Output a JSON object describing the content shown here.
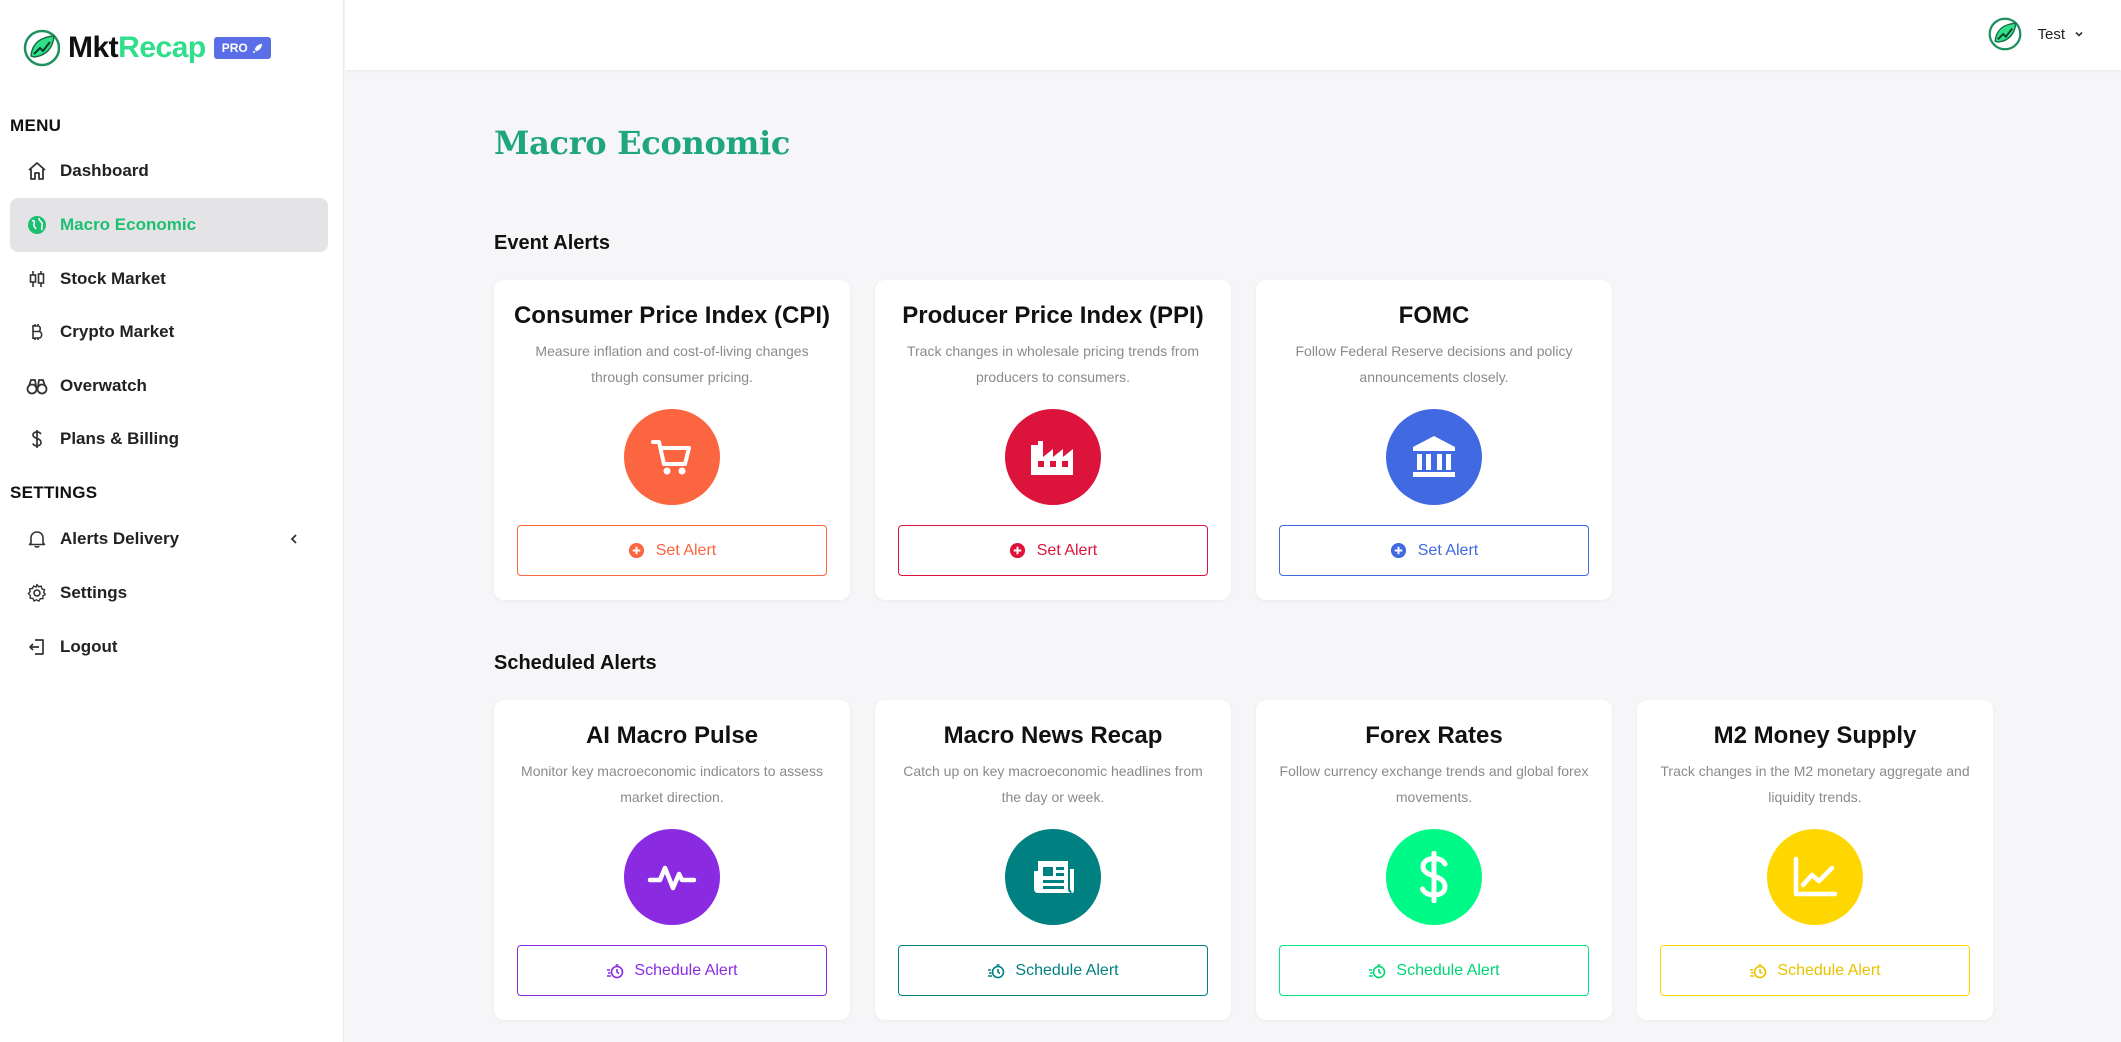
{
  "app": {
    "logo_part1": "Mkt",
    "logo_part2": "Recap",
    "badge": "PRO"
  },
  "sidebar": {
    "menu_label": "MENU",
    "menu_items": [
      {
        "label": "Dashboard",
        "icon": "home-icon"
      },
      {
        "label": "Macro Economic",
        "icon": "globe-icon",
        "active": true
      },
      {
        "label": "Stock Market",
        "icon": "candlestick-icon"
      },
      {
        "label": "Crypto Market",
        "icon": "bitcoin-icon"
      },
      {
        "label": "Overwatch",
        "icon": "binoculars-icon"
      },
      {
        "label": "Plans & Billing",
        "icon": "dollar-icon"
      }
    ],
    "settings_label": "SETTINGS",
    "settings_items": [
      {
        "label": "Alerts Delivery",
        "icon": "bell-icon"
      },
      {
        "label": "Settings",
        "icon": "gear-icon"
      },
      {
        "label": "Logout",
        "icon": "logout-icon"
      }
    ]
  },
  "topbar": {
    "user_name": "Test"
  },
  "main": {
    "page_title": "Macro Economic",
    "event_alerts": {
      "title": "Event Alerts",
      "cards": [
        {
          "title": "Consumer Price Index (CPI)",
          "desc": "Measure inflation and cost-of-living changes through consumer pricing.",
          "icon": "cart-icon",
          "button": "Set Alert",
          "color": "#fb6540"
        },
        {
          "title": "Producer Price Index (PPI)",
          "desc": "Track changes in wholesale pricing trends from producers to consumers.",
          "icon": "factory-icon",
          "button": "Set Alert",
          "color": "#dc143c"
        },
        {
          "title": "FOMC",
          "desc": "Follow Federal Reserve decisions and policy announcements closely.",
          "icon": "bank-icon",
          "button": "Set Alert",
          "color": "#4169e1"
        }
      ]
    },
    "scheduled_alerts": {
      "title": "Scheduled Alerts",
      "cards": [
        {
          "title": "AI Macro Pulse",
          "desc": "Monitor key macroeconomic indicators to assess market direction.",
          "icon": "pulse-icon",
          "button": "Schedule Alert",
          "color": "#8a2be2"
        },
        {
          "title": "Macro News Recap",
          "desc": "Catch up on key macroeconomic headlines from the day or week.",
          "icon": "newspaper-icon",
          "button": "Schedule Alert",
          "color": "#008080"
        },
        {
          "title": "Forex Rates",
          "desc": "Follow currency exchange trends and global forex movements.",
          "icon": "dollar-icon",
          "button": "Schedule Alert",
          "color": "#00fa87"
        },
        {
          "title": "M2 Money Supply",
          "desc": "Track changes in the M2 monetary aggregate and liquidity trends.",
          "icon": "chart-line-icon",
          "button": "Schedule Alert",
          "color": "#ffd700"
        }
      ]
    }
  }
}
